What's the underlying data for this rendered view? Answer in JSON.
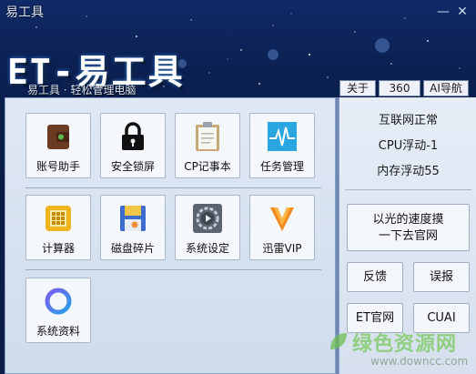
{
  "window": {
    "title": "易工具",
    "minimize_glyph": "—",
    "close_glyph": "✕"
  },
  "brand": {
    "name": "ET-易工具",
    "slogan": "易工具 · 轻松管理电脑"
  },
  "top_tabs": [
    {
      "label": "关于"
    },
    {
      "label": "360"
    },
    {
      "label": "AI导航"
    }
  ],
  "tools": [
    {
      "label": "账号助手",
      "icon": "wallet-icon"
    },
    {
      "label": "安全锁屏",
      "icon": "lock-icon"
    },
    {
      "label": "CP记事本",
      "icon": "clipboard-icon"
    },
    {
      "label": "任务管理",
      "icon": "pulse-icon"
    },
    {
      "label": "计算器",
      "icon": "calculator-icon"
    },
    {
      "label": "磁盘碎片",
      "icon": "floppy-icon"
    },
    {
      "label": "系统设定",
      "icon": "settings-play-icon"
    },
    {
      "label": "迅雷VIP",
      "icon": "thunder-icon"
    },
    {
      "label": "系统资料",
      "icon": "ring-icon"
    }
  ],
  "status": {
    "network": "互联网正常",
    "cpu": "CPU浮动-1",
    "memory": "内存浮动55"
  },
  "right_buttons": {
    "website_line1": "以光的速度摸",
    "website_line2": "一下去官网",
    "feedback": "反馈",
    "report": "误报",
    "et_site": "ET官网",
    "cuai": "CUAI"
  },
  "watermark": {
    "line1": "绿色资源网",
    "line2": "www.downcc.com"
  },
  "colors": {
    "accent": "#3a7ad8",
    "panel": "#dfe8f4",
    "watermark_green": "#78c85a"
  }
}
